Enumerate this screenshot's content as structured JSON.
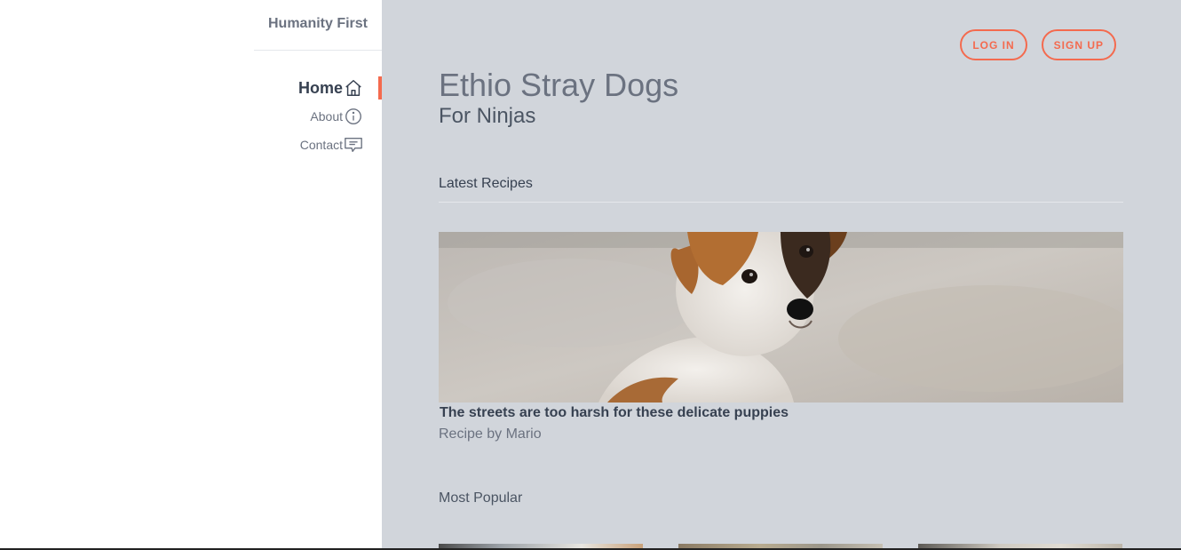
{
  "brand": "Humanity First",
  "nav": {
    "items": [
      {
        "label": "Home",
        "icon": "home-icon"
      },
      {
        "label": "About",
        "icon": "info-icon"
      },
      {
        "label": "Contact",
        "icon": "chat-icon"
      }
    ]
  },
  "auth": {
    "login": "LOG IN",
    "signup": "SIGN UP"
  },
  "header": {
    "title": "Ethio Stray Dogs",
    "subtitle": "For Ninjas"
  },
  "latest": {
    "heading": "Latest Recipes",
    "card": {
      "title": "The streets are too harsh for these delicate puppies",
      "byline": "Recipe by Mario"
    }
  },
  "popular": {
    "heading": "Most Popular"
  },
  "colors": {
    "accent": "#f46a4e",
    "main_bg": "#d1d5db"
  }
}
